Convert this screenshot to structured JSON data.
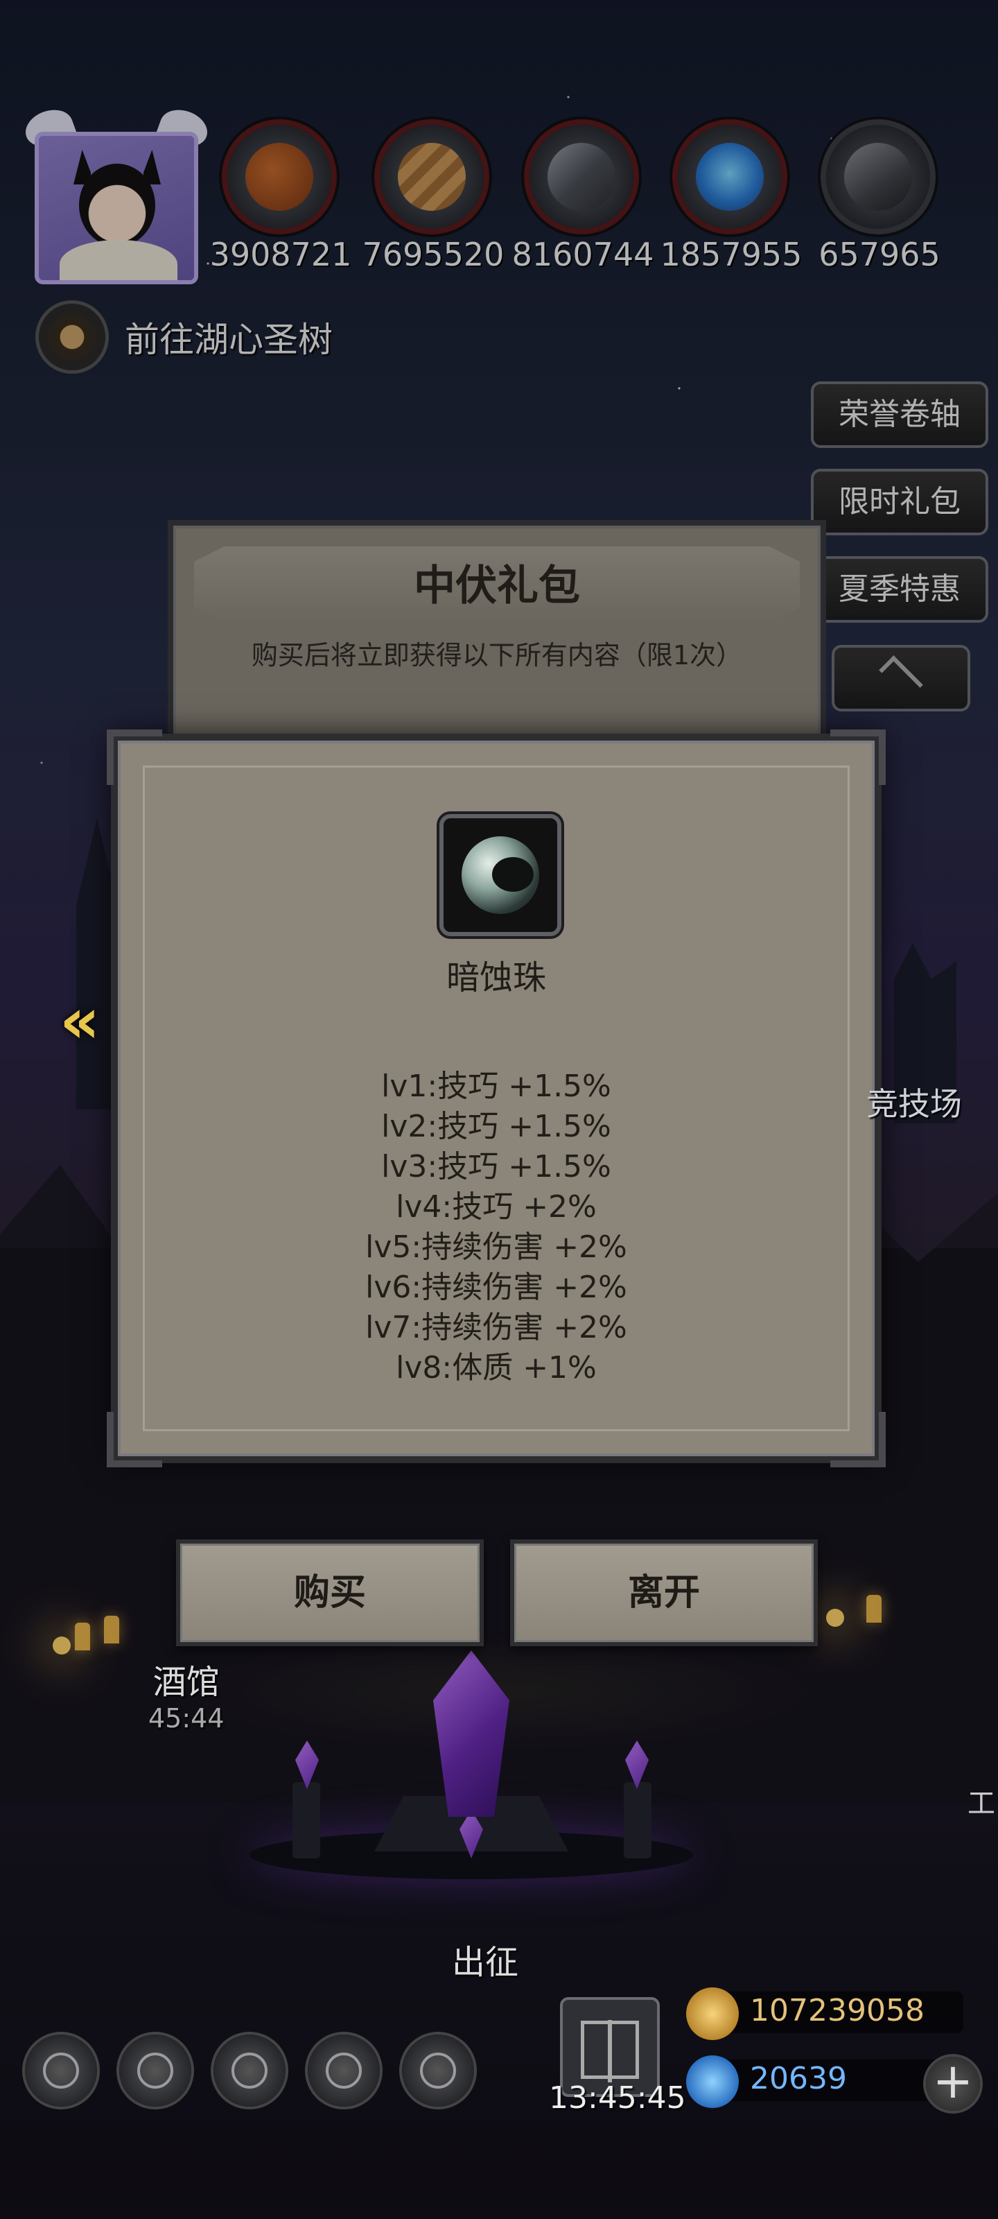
{
  "resources": [
    {
      "icon": "meat-icon",
      "value": "3908721"
    },
    {
      "icon": "wood-icon",
      "value": "7695520"
    },
    {
      "icon": "iron-icon",
      "value": "8160744"
    },
    {
      "icon": "crystal-icon",
      "value": "1857955"
    },
    {
      "icon": "ore-icon",
      "value": "657965"
    }
  ],
  "quest": {
    "text": "前往湖心圣树"
  },
  "side_menu": {
    "honor_scroll": "荣誉卷轴",
    "limited_pack": "限时礼包",
    "summer_sale": "夏季特惠"
  },
  "gift_dialog": {
    "title": "中伏礼包",
    "description": "购买后将立即获得以下所有内容（限1次）"
  },
  "item": {
    "name": "暗蚀珠",
    "stats": [
      "lv1:技巧 +1.5%",
      "lv2:技巧 +1.5%",
      "lv3:技巧 +1.5%",
      "lv4:技巧 +2%",
      "lv5:持续伤害 +2%",
      "lv6:持续伤害 +2%",
      "lv7:持续伤害 +2%",
      "lv8:体质 +1%"
    ]
  },
  "buttons": {
    "buy": "购买",
    "leave": "离开"
  },
  "map_labels": {
    "arena": "竞技场",
    "tavern": "酒馆",
    "tavern_timer": "45:44",
    "depart": "出征",
    "edge_char": "工"
  },
  "bottom": {
    "gift_timer": "13:45:45",
    "gold": "107239058",
    "gems": "20639"
  },
  "colors": {
    "panel": "#8c8579",
    "gold_text": "#e5c27a",
    "gem_text": "#74b7ff",
    "accent_arrow": "#e9c54c"
  }
}
